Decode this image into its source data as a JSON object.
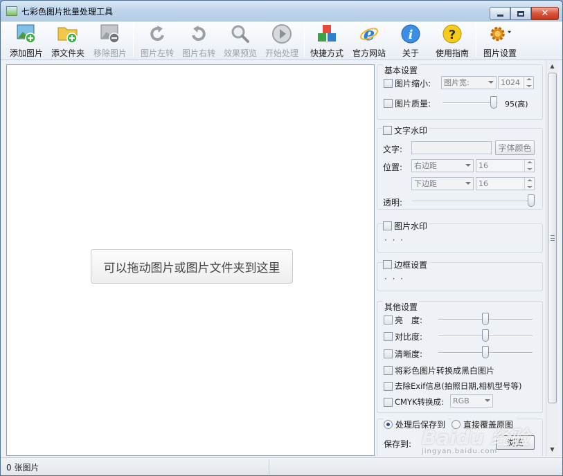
{
  "window": {
    "title": "七彩色图片批量处理工具"
  },
  "toolbar": {
    "items": [
      {
        "label": "添加图片",
        "icon": "add-image-icon"
      },
      {
        "label": "添文件夹",
        "icon": "add-folder-icon"
      },
      {
        "label": "移除图片",
        "icon": "remove-image-icon"
      },
      {
        "label": "图片左转",
        "icon": "rotate-left-icon"
      },
      {
        "label": "图片右转",
        "icon": "rotate-right-icon"
      },
      {
        "label": "效果预览",
        "icon": "magnifier-icon"
      },
      {
        "label": "开始处理",
        "icon": "play-icon"
      },
      {
        "label": "快捷方式",
        "icon": "cubes-icon"
      },
      {
        "label": "官方网站",
        "icon": "ie-browser-icon"
      },
      {
        "label": "关于",
        "icon": "info-icon"
      },
      {
        "label": "使用指南",
        "icon": "help-icon"
      },
      {
        "label": "图片设置",
        "icon": "gear-icon"
      }
    ]
  },
  "main": {
    "drop_hint": "可以拖动图片或图片文件夹到这里"
  },
  "basic": {
    "title": "基本设置",
    "shrink_label": "图片缩小:",
    "shrink_mode": "图片宽:",
    "shrink_value": "1024",
    "quality_label": "图片质量:",
    "quality_value": "95(高)",
    "quality_fraction": 0.93
  },
  "text_watermark": {
    "title": "文字水印",
    "text_label": "文字:",
    "font_color_button": "字体颜色",
    "position_label": "位置:",
    "h_margin": "右边距",
    "h_value": "16",
    "v_margin": "下边距",
    "v_value": "16",
    "opacity_label": "透明:",
    "opacity_fraction": 1.0
  },
  "image_watermark": {
    "title": "图片水印",
    "placeholder": "· · ·"
  },
  "border": {
    "title": "边框设置",
    "placeholder": "· · ·"
  },
  "other": {
    "title": "其他设置",
    "brightness_label": "亮　度:",
    "contrast_label": "对比度:",
    "sharpness_label": "清晰度:",
    "grayscale_label": "将彩色图片转换成黑白图片",
    "remove_exif_label": "去除Exif信息(拍照日期,相机型号等)",
    "cmyk_label": "CMYK转换成:",
    "cmyk_value": "RGB"
  },
  "output": {
    "save_to_option": "处理后保存到",
    "overwrite_option": "直接覆盖原图",
    "save_path_label": "保存到:",
    "browse_button": "浏览"
  },
  "status": {
    "count_text": "0 张图片"
  },
  "watermark_text": {
    "brand": "Baidu 经验",
    "url": "jingyan.baidu.com"
  }
}
